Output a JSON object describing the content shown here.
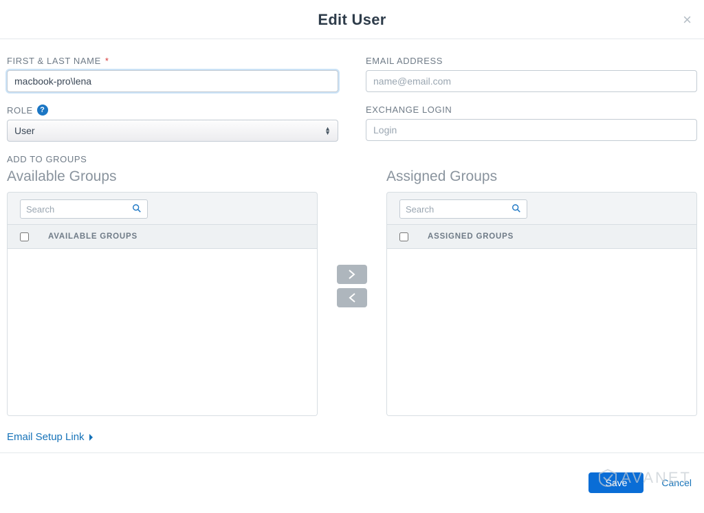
{
  "header": {
    "title": "Edit User"
  },
  "fields": {
    "name_label": "FIRST & LAST NAME",
    "name_value": "macbook-pro\\lena",
    "email_label": "EMAIL ADDRESS",
    "email_placeholder": "name@email.com",
    "role_label": "ROLE",
    "role_value": "User",
    "exchange_label": "EXCHANGE LOGIN",
    "exchange_placeholder": "Login"
  },
  "groups": {
    "section_label": "ADD TO GROUPS",
    "available": {
      "title": "Available Groups",
      "search_placeholder": "Search",
      "column_header": "AVAILABLE GROUPS"
    },
    "assigned": {
      "title": "Assigned Groups",
      "search_placeholder": "Search",
      "column_header": "ASSIGNED GROUPS"
    }
  },
  "links": {
    "email_setup": "Email Setup Link"
  },
  "actions": {
    "save": "Save",
    "cancel": "Cancel"
  },
  "watermark": "AVANET"
}
